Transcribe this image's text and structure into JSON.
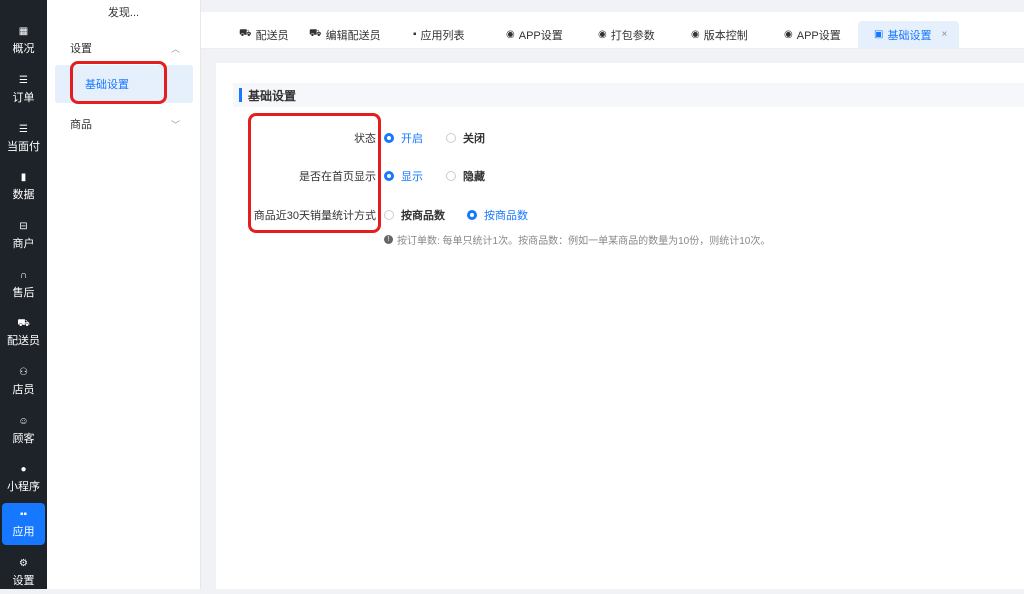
{
  "nav": {
    "items": [
      {
        "label": "概况",
        "icon": "dashboard-icon",
        "glyph": "▦"
      },
      {
        "label": "订单",
        "icon": "list-icon",
        "glyph": "☰"
      },
      {
        "label": "当面付",
        "icon": "list-icon",
        "glyph": "☰"
      },
      {
        "label": "数据",
        "icon": "bar-chart-icon",
        "glyph": "▮"
      },
      {
        "label": "商户",
        "icon": "store-icon",
        "glyph": "⊟"
      },
      {
        "label": "售后",
        "icon": "headset-icon",
        "glyph": "∩"
      },
      {
        "label": "配送员",
        "icon": "delivery-icon",
        "glyph": "⛟"
      },
      {
        "label": "店员",
        "icon": "user-group-icon",
        "glyph": "⚇"
      },
      {
        "label": "顾客",
        "icon": "customer-icon",
        "glyph": "☺"
      },
      {
        "label": "小程序",
        "icon": "wechat-icon",
        "glyph": "●"
      },
      {
        "label": "应用",
        "icon": "apps-icon",
        "glyph": "▪▪"
      },
      {
        "label": "设置",
        "icon": "settings-user-icon",
        "glyph": "⚙"
      }
    ]
  },
  "subnav": {
    "top": "发现...",
    "group_settings": "设置",
    "item_basic": "基础设置",
    "group_goods": "商品"
  },
  "tabs": [
    {
      "label": "配送员",
      "icon": "delivery-icon",
      "glyph": "⛟"
    },
    {
      "label": "编辑配送员",
      "icon": "delivery-icon",
      "glyph": "⛟"
    },
    {
      "label": "应用列表",
      "icon": "apps-icon",
      "glyph": "▪"
    },
    {
      "label": "APP设置",
      "icon": "app-icon",
      "glyph": "◉"
    },
    {
      "label": "打包参数",
      "icon": "app-icon",
      "glyph": "◉"
    },
    {
      "label": "版本控制",
      "icon": "app-icon",
      "glyph": "◉"
    },
    {
      "label": "APP设置",
      "icon": "app-icon",
      "glyph": "◉"
    },
    {
      "label": "基础设置",
      "icon": "bookmark-icon",
      "glyph": "▣"
    }
  ],
  "tab_close": "×",
  "section": {
    "title": "基础设置"
  },
  "form": {
    "status": {
      "label": "状态",
      "opt1": "开启",
      "opt2": "关闭",
      "selected": "开启"
    },
    "homepage": {
      "label": "是否在首页显示",
      "opt1": "显示",
      "opt2": "隐藏",
      "selected": "显示"
    },
    "sales": {
      "label": "商品近30天销量统计方式",
      "opt1": "按商品数",
      "opt2": "按商品数",
      "selected": 2
    },
    "hint": "按订单数: 每单只统计1次。按商品数：例如一单某商品的数量为10份，则统计10次。",
    "hint_icon": "!"
  }
}
